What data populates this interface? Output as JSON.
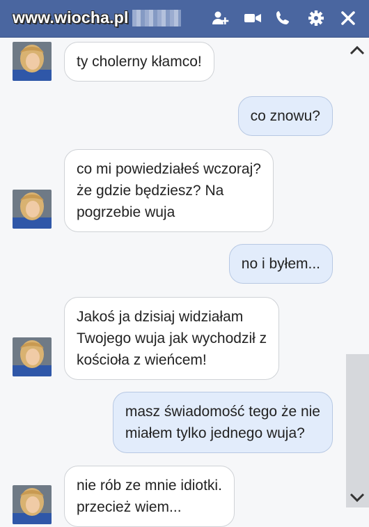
{
  "header": {
    "watermark": "www.wiocha.pl",
    "icons": [
      "add-friend-icon",
      "video-call-icon",
      "phone-icon",
      "gear-icon",
      "close-icon"
    ]
  },
  "messages": [
    {
      "from": "them",
      "text": "ty cholerny kłamco!"
    },
    {
      "from": "me",
      "text": "co znowu?"
    },
    {
      "from": "them",
      "text": "co mi powiedziałeś wczoraj?\nże gdzie będziesz? Na\npogrzebie wuja"
    },
    {
      "from": "me",
      "text": "no i byłem..."
    },
    {
      "from": "them",
      "text": "Jakoś ja dzisiaj widziałam\nTwojego wuja jak wychodził z\nkościoła z wieńcem!"
    },
    {
      "from": "me",
      "text": "masz świadomość tego że nie\nmiałem tylko jednego wuja?"
    },
    {
      "from": "them",
      "text": "nie rób ze mnie idiotki.\nprzecież wiem..."
    }
  ],
  "colors": {
    "header": "#4a66a0",
    "incoming_bubble": "#ffffff",
    "outgoing_bubble": "#e2ecfb"
  }
}
